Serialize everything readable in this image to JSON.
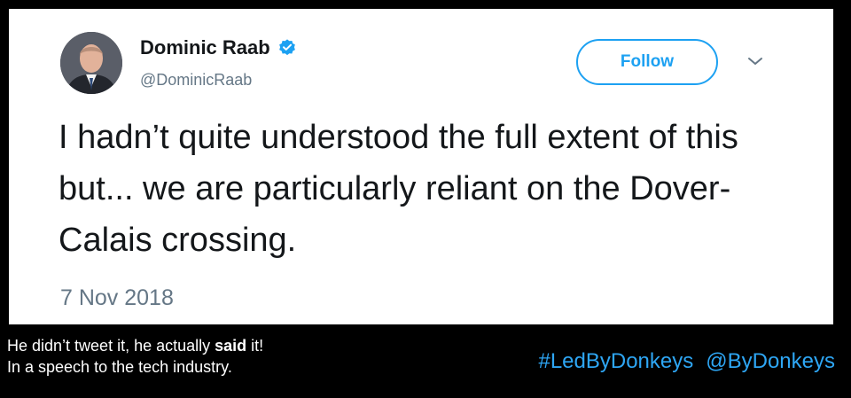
{
  "tweet": {
    "display_name": "Dominic Raab",
    "handle": "@DominicRaab",
    "follow_label": "Follow",
    "text": "I hadn’t quite understood the full extent of this but... we are particularly reliant on the Dover-Calais crossing.",
    "date": "7 Nov 2018"
  },
  "caption": {
    "line1_before": "He didn’t tweet it, he actually ",
    "line1_bold": "said",
    "line1_after": " it!",
    "line2": "In a speech to the tech industry."
  },
  "tags": {
    "hashtag": "#LedByDonkeys",
    "mention": "@ByDonkeys"
  },
  "icons": {
    "verified": "verified-badge-icon",
    "menu": "chevron-down-icon"
  },
  "colors": {
    "accent": "#1da1f2",
    "hashtag": "#2ea6f4",
    "secondary_text": "#657786",
    "background": "#000000",
    "card": "#ffffff"
  }
}
